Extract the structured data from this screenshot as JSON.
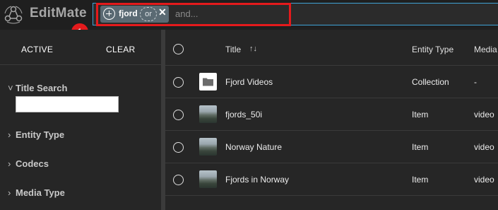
{
  "app": {
    "name": "EditMate"
  },
  "search": {
    "chip_term": "fjord",
    "chip_operator": "or",
    "chip_remove_glyph": "✕",
    "placeholder": "and...",
    "highlight_color": "#e41a1c",
    "accent_color": "#3fa3d6"
  },
  "markers": [
    "1",
    "2"
  ],
  "sidebar": {
    "active_label": "ACTIVE",
    "clear_label": "CLEAR",
    "facets": [
      {
        "label": "Title Search",
        "expanded": true
      },
      {
        "label": "Entity Type",
        "expanded": false
      },
      {
        "label": "Codecs",
        "expanded": false
      },
      {
        "label": "Media Type",
        "expanded": false
      }
    ]
  },
  "table": {
    "columns": [
      "Title",
      "Entity Type",
      "Media"
    ],
    "sort_icon": "↑↓",
    "rows": [
      {
        "title": "Fjord Videos",
        "entity_type": "Collection",
        "media": "-",
        "thumb": "folder-icon"
      },
      {
        "title": "fjords_50i",
        "entity_type": "Item",
        "media": "video",
        "thumb": "landscape-thumbnail"
      },
      {
        "title": "Norway Nature",
        "entity_type": "Item",
        "media": "video",
        "thumb": "landscape-thumbnail"
      },
      {
        "title": "Fjords in Norway",
        "entity_type": "Item",
        "media": "video",
        "thumb": "landscape-thumbnail"
      }
    ]
  }
}
